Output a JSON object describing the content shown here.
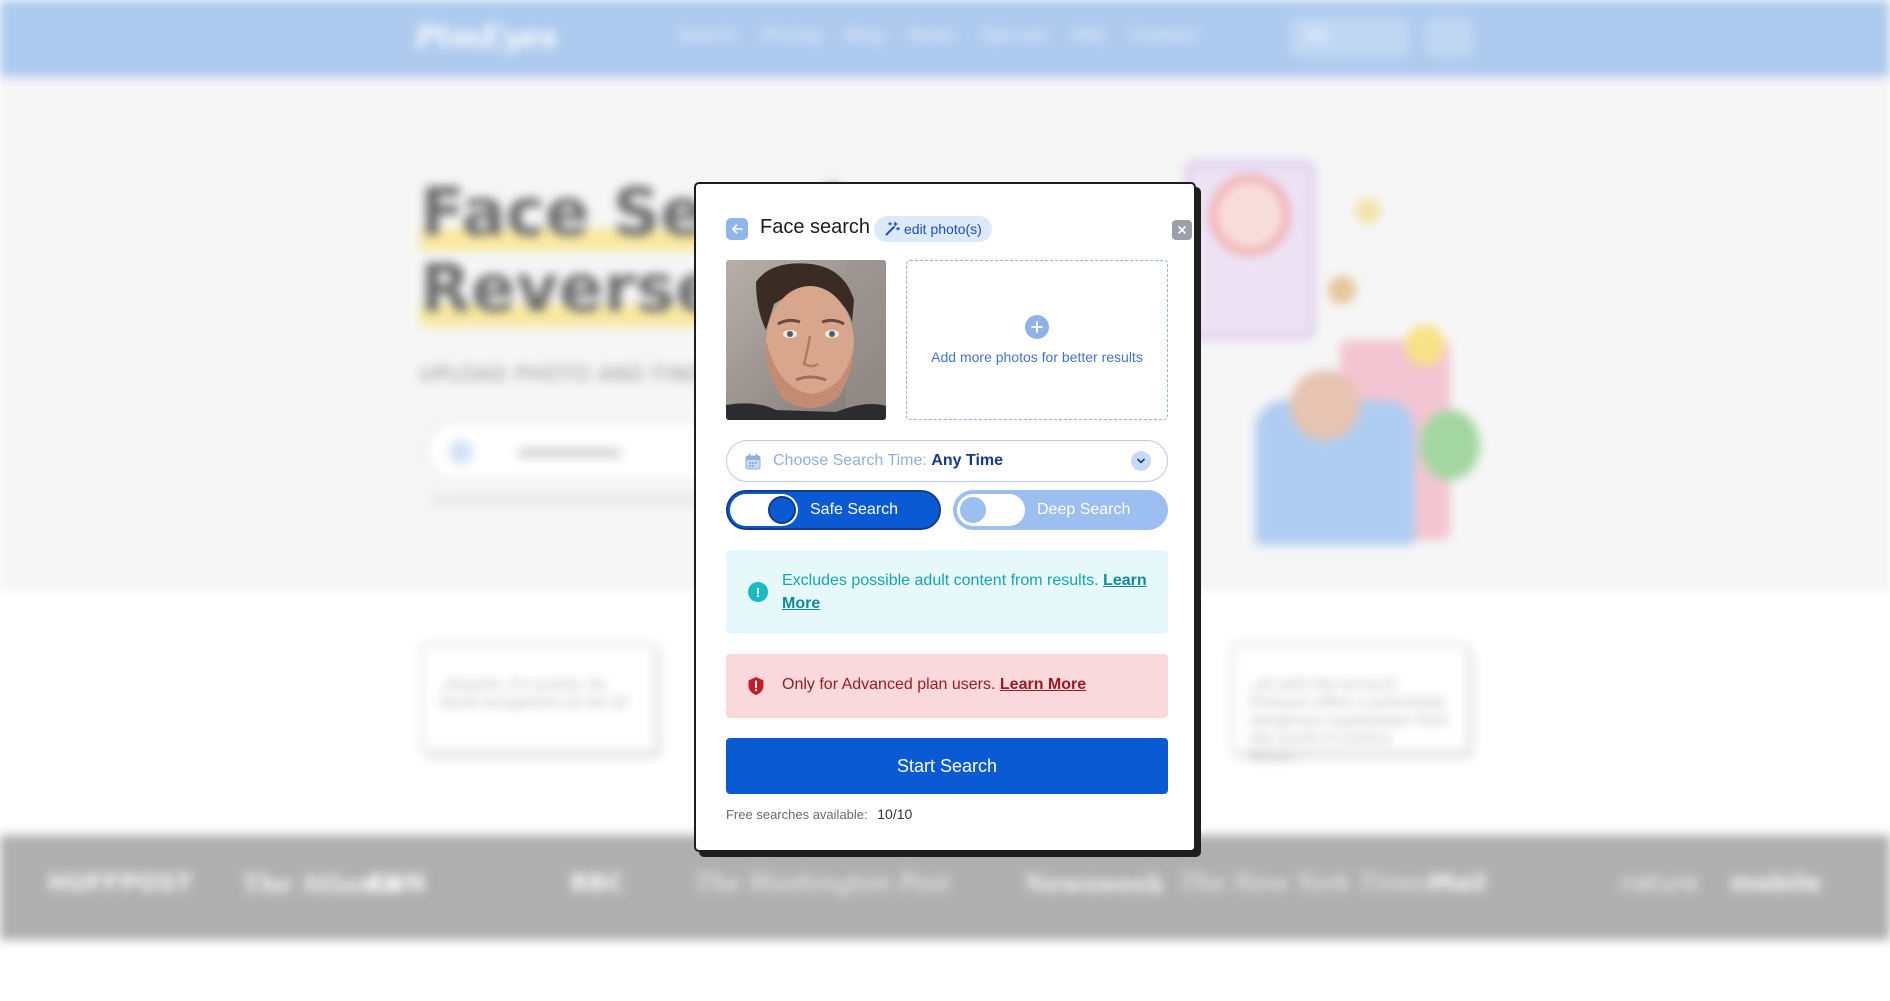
{
  "background": {
    "logo": "PimEyes",
    "nav": [
      "Search",
      "Pricing",
      "Blog",
      "News",
      "Opt-out",
      "FAQ",
      "Contact"
    ],
    "language": "EN",
    "hero_title_line1": "Face Search",
    "hero_title_line2": "Reverse Image",
    "hero_subtitle": "UPLOAD PHOTO AND FIND",
    "testimonials": [
      "„Acquire, it's scarily, its, facial recognition as we all",
      "",
      "„As with the account Pimeyes offers a potentially dangerous superpower from the world of science fiction.”"
    ],
    "press_logos": [
      "HUFFPOST",
      "The Atlanta",
      "CNN",
      "BBC",
      "The Washington Post",
      "Newsweek",
      "The New York Times",
      "Mail",
      "nature",
      "mobile"
    ]
  },
  "modal": {
    "title": "Face search",
    "edit_label": "edit photo(s)",
    "add_more_text": "Add more photos for better results",
    "time_label": "Choose Search Time:",
    "time_value": "Any Time",
    "toggles": {
      "safe_label": "Safe Search",
      "deep_label": "Deep Search"
    },
    "info": {
      "text": "Excludes possible adult content from results.",
      "link": "Learn More"
    },
    "warning": {
      "text": "Only for Advanced plan users.",
      "link": "Learn More"
    },
    "start_label": "Start Search",
    "free_label": "Free searches available:",
    "free_count": "10/10"
  },
  "colors": {
    "primary": "#0a5ad4",
    "info": "#12a4b3",
    "danger": "#9a1a24",
    "header_bg": "#9dbfeb"
  },
  "icons": {
    "back": "arrow-left-icon",
    "edit": "magic-wand-icon",
    "close": "close-icon",
    "add": "plus-icon",
    "calendar": "calendar-icon",
    "chevron": "chevron-down-icon",
    "info": "info-icon",
    "warning": "shield-alert-icon"
  }
}
